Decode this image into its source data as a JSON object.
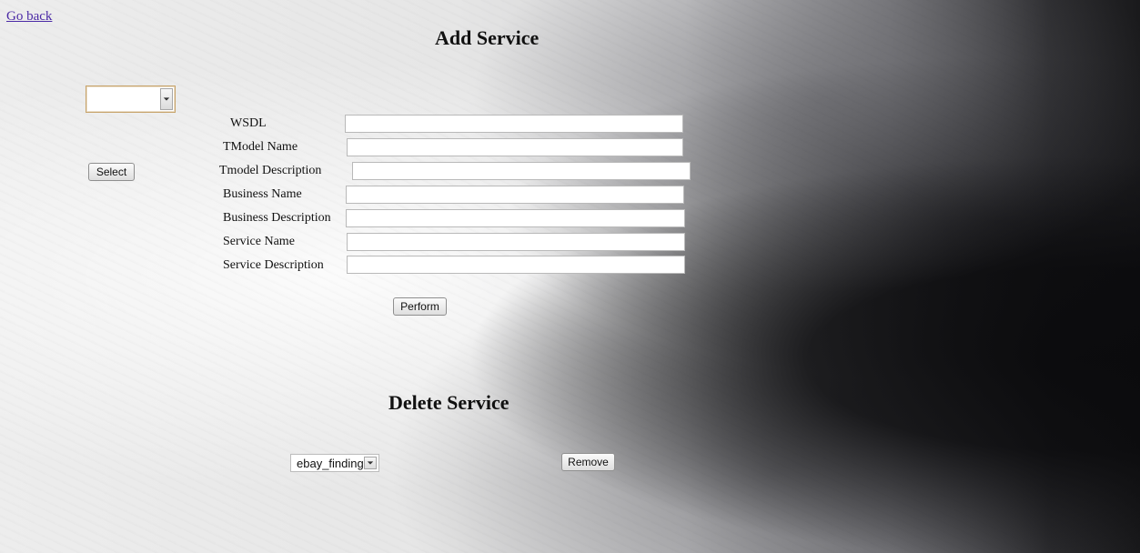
{
  "nav": {
    "go_back": "Go back"
  },
  "add_service": {
    "title": "Add Service",
    "service_select": {
      "selected": ""
    },
    "select_button": "Select",
    "fields": [
      {
        "label": "WSDL",
        "value": ""
      },
      {
        "label": "TModel Name",
        "value": ""
      },
      {
        "label": "Tmodel Description",
        "value": ""
      },
      {
        "label": "Business Name",
        "value": ""
      },
      {
        "label": "Business Description",
        "value": ""
      },
      {
        "label": "Service Name",
        "value": ""
      },
      {
        "label": "Service Description",
        "value": ""
      }
    ],
    "perform_button": "Perform"
  },
  "delete_service": {
    "title": "Delete Service",
    "service_select": {
      "selected": "ebay_finding"
    },
    "remove_button": "Remove"
  },
  "icons": {
    "dropdown_arrow": "chevron-down-icon"
  },
  "colors": {
    "link": "#4b2aa6",
    "select_focus_border": "#c7a36a"
  }
}
